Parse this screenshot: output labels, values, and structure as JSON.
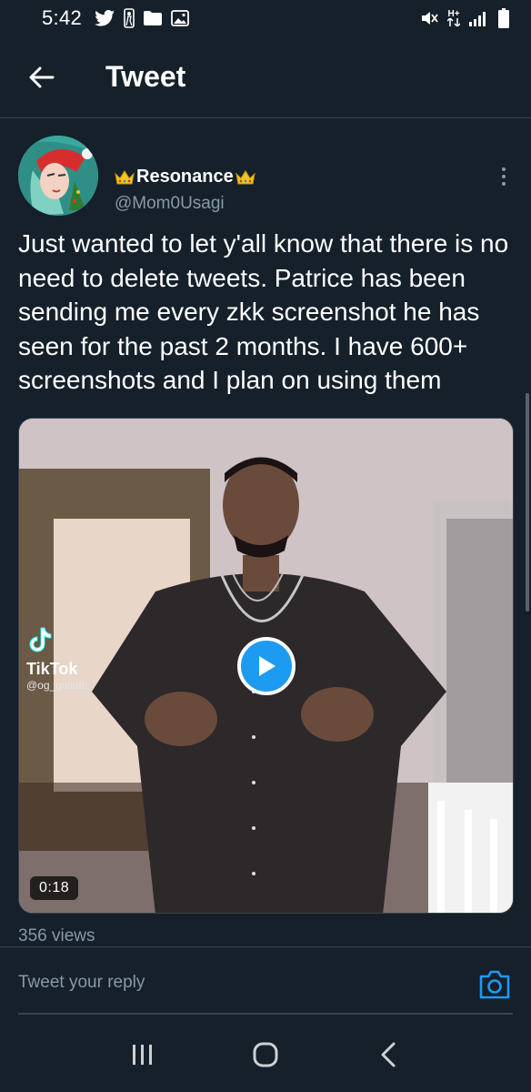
{
  "status_bar": {
    "time": "5:42",
    "left_icons": [
      "twitter-icon",
      "nba-icon",
      "folder-icon",
      "image-icon"
    ],
    "right_icons": [
      "mute-icon",
      "network-hplus-icon",
      "signal-icon",
      "battery-icon"
    ],
    "network_label": "H+"
  },
  "header": {
    "title": "Tweet",
    "back_icon": "back-arrow-icon"
  },
  "tweet": {
    "author": {
      "display_name": "Resonance",
      "handle": "@Mom0Usagi",
      "name_decoration_icon": "crown-icon"
    },
    "text": "Just wanted to let y'all know that there is no need to delete tweets. Patrice has been sending me every zkk screenshot he has seen for the past 2 months. I have 600+ screenshots and I plan on using them",
    "media": {
      "type": "video",
      "watermark_brand": "TikTok",
      "watermark_user": "@og_goliath",
      "duration": "0:18"
    },
    "views": "356 views"
  },
  "reply": {
    "placeholder": "Tweet your reply",
    "camera_icon": "camera-icon"
  },
  "nav_bar": {
    "buttons": [
      "recents-icon",
      "home-icon",
      "back-icon"
    ]
  },
  "colors": {
    "background": "#15202b",
    "accent": "#1d9bf0",
    "secondary_text": "#8899a6",
    "divider": "#38444d",
    "crown": "#f5c518"
  }
}
